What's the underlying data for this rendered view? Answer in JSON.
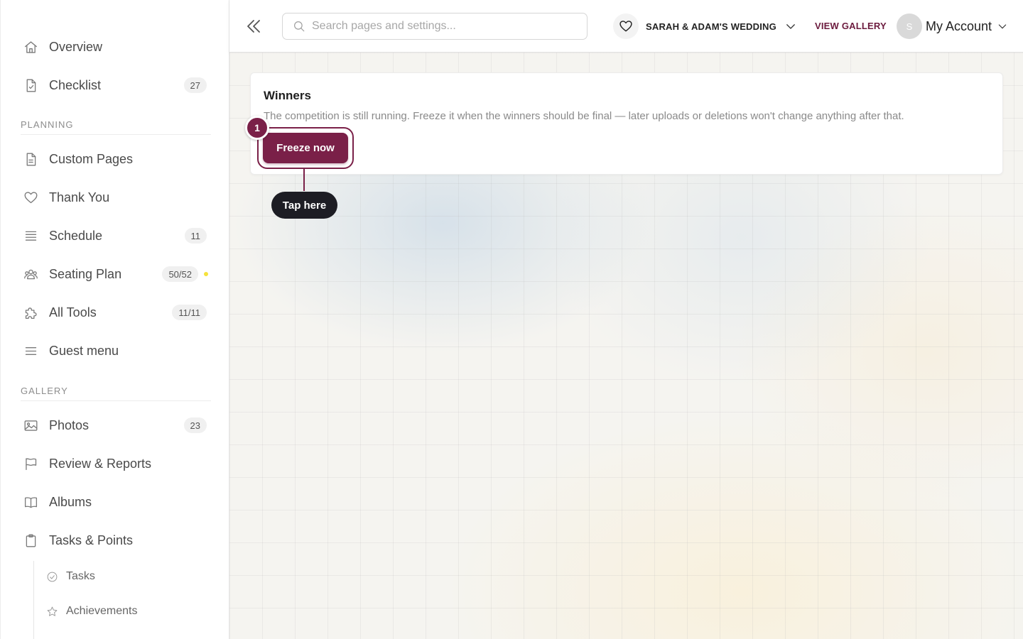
{
  "sidebar": {
    "items": [
      {
        "label": "Overview",
        "icon": "home-icon"
      },
      {
        "label": "Checklist",
        "icon": "checklist-icon",
        "badge": "27"
      }
    ],
    "sections": {
      "planning": {
        "label": "PLANNING",
        "items": [
          {
            "label": "Custom Pages",
            "icon": "document-icon"
          },
          {
            "label": "Thank You",
            "icon": "heart-icon"
          },
          {
            "label": "Schedule",
            "icon": "list-icon",
            "badge": "11"
          },
          {
            "label": "Seating Plan",
            "icon": "people-icon",
            "badge": "50/52",
            "dot_color": "#f5e23b"
          },
          {
            "label": "All Tools",
            "icon": "puzzle-icon",
            "badge": "11/11"
          },
          {
            "label": "Guest menu",
            "icon": "menu-icon"
          }
        ]
      },
      "gallery": {
        "label": "GALLERY",
        "items": [
          {
            "label": "Photos",
            "icon": "image-icon",
            "badge": "23"
          },
          {
            "label": "Review & Reports",
            "icon": "flag-icon"
          },
          {
            "label": "Albums",
            "icon": "book-icon"
          },
          {
            "label": "Tasks & Points",
            "icon": "clipboard-icon"
          }
        ],
        "subitems": [
          {
            "label": "Tasks",
            "icon": "check-circle-icon"
          },
          {
            "label": "Achievements",
            "icon": "star-icon"
          }
        ]
      }
    }
  },
  "topbar": {
    "search_placeholder": "Search pages and settings...",
    "event_name": "SARAH & ADAM'S WEDDING",
    "view_gallery": "VIEW GALLERY",
    "avatar_initial": "S",
    "account_label": "My Account"
  },
  "main": {
    "card": {
      "title": "Winners",
      "description": "The competition is still running. Freeze it when the winners should be final — later uploads or deletions won't change anything after that.",
      "button_label": "Freeze now"
    },
    "tutorial": {
      "step": "1",
      "tooltip": "Tap here"
    }
  },
  "colors": {
    "brand": "#7a2048",
    "tooltip_bg": "#1d1d24",
    "seating_dot": "#f5e23b"
  }
}
